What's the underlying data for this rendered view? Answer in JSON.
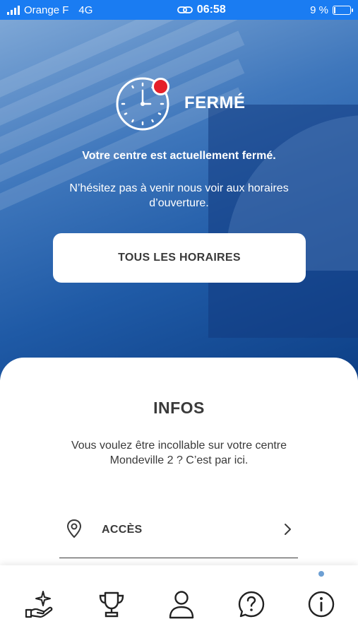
{
  "status_bar": {
    "carrier": "Orange F",
    "network": "4G",
    "time": "06:58",
    "battery": "9 %",
    "battery_level": 0.09
  },
  "hero": {
    "status_title": "FERMÉ",
    "message": "Votre centre est actuellement fermé.",
    "sub_message": "N’hésitez pas à venir nous voir aux horaires d’ouverture.",
    "hours_button": "TOUS LES HORAIRES",
    "status_color": "#e5202a"
  },
  "info": {
    "title": "INFOS",
    "text": "Vous voulez être incollable sur votre centre Mondeville 2 ? C’est par ici.",
    "rows": [
      {
        "label": "ACCÈS",
        "icon": "map-pin-icon"
      }
    ]
  },
  "tab_bar": {
    "items": [
      {
        "icon": "hand-sparkle-icon"
      },
      {
        "icon": "trophy-icon"
      },
      {
        "icon": "user-icon"
      },
      {
        "icon": "help-circle-icon"
      },
      {
        "icon": "info-circle-icon",
        "active": true
      }
    ]
  },
  "colors": {
    "status_bar_bg": "#1a7cf2",
    "text": "#3a3a3a",
    "active_dot": "#6d9fd3"
  }
}
